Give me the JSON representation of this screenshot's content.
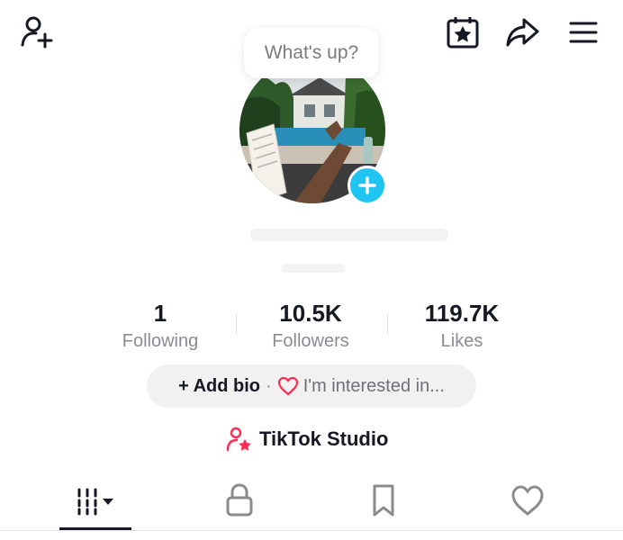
{
  "header": {
    "bubble_text": "What's up?"
  },
  "stats": [
    {
      "value": "1",
      "label": "Following"
    },
    {
      "value": "10.5K",
      "label": "Followers"
    },
    {
      "value": "119.7K",
      "label": "Likes"
    }
  ],
  "bio": {
    "add_bio": "+ Add bio",
    "separator": "·",
    "interests": "I'm interested in..."
  },
  "studio": {
    "label": "TikTok Studio"
  },
  "colors": {
    "accent_blue": "#20c4f0",
    "brand_pink": "#fe2c55",
    "text_primary": "#161823",
    "text_secondary": "#8a8b91"
  },
  "icons": {
    "top_left": "add-friend-icon",
    "top_right": [
      "calendar-star-icon",
      "share-icon",
      "menu-icon"
    ],
    "tabs": [
      "videos-grid-icon",
      "private-lock-icon",
      "bookmark-icon",
      "liked-heart-icon"
    ]
  }
}
